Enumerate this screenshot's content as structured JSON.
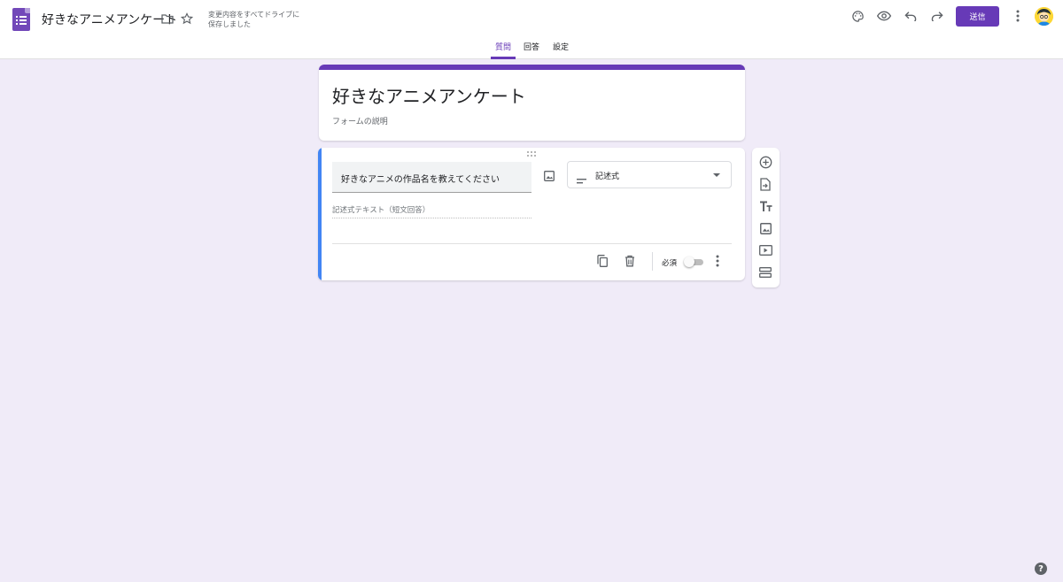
{
  "header": {
    "doc_title": "好きなアニメアンケート",
    "save_status": "変更内容をすべてドライブに保存しました",
    "send_label": "送信",
    "icons": [
      "folder-icon",
      "star-icon",
      "palette-icon",
      "preview-eye-icon",
      "undo-icon",
      "redo-icon",
      "more-vert-icon"
    ]
  },
  "tabs": [
    {
      "label": "質問",
      "active": true
    },
    {
      "label": "回答",
      "active": false
    },
    {
      "label": "設定",
      "active": false
    }
  ],
  "form": {
    "title": "好きなアニメアンケート",
    "description_placeholder": "フォームの説明"
  },
  "question": {
    "text": "好きなアニメの作品名を教えてください",
    "type": "記述式",
    "answer_placeholder": "記述式テキスト（短文回答）",
    "required_label": "必須",
    "required": false
  },
  "side_toolbar": [
    "add-question-icon",
    "import-questions-icon",
    "add-title-icon",
    "add-image-icon",
    "add-video-icon",
    "add-section-icon"
  ],
  "colors": {
    "accent": "#673ab7",
    "background": "#f0ebf8",
    "active_question_bar": "#4285f4"
  },
  "help_label": "?"
}
